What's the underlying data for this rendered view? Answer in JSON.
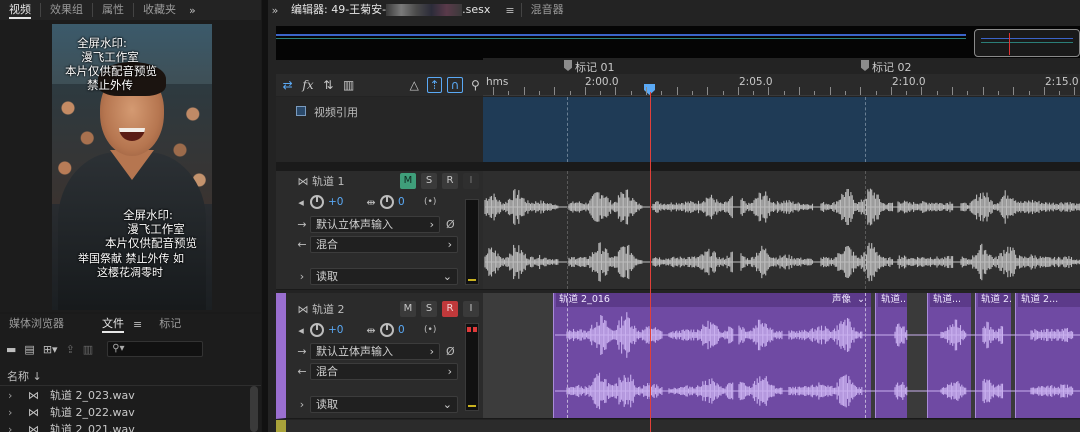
{
  "left_panel": {
    "tabs": [
      "视频",
      "效果组",
      "属性",
      "收藏夹"
    ],
    "watermark_top": [
      "全屏水印:",
      "漫飞工作室",
      "本片仅供配音预览",
      "禁止外传"
    ],
    "watermark_bottom": [
      "全屏水印:",
      "漫飞工作室",
      "本片仅供配音预览"
    ],
    "subtitle": [
      "举国祭献 禁止外传 如",
      "这樱花凋零时"
    ]
  },
  "media_panel": {
    "tabs": [
      "媒体浏览器",
      "文件",
      "标记"
    ],
    "column_name": "名称",
    "files": [
      "轨道 2_023.wav",
      "轨道 2_022.wav",
      "轨道 2_021.wav"
    ]
  },
  "editor": {
    "title": "编辑器: 49-王菊安-",
    "title_ext": ".sesx",
    "mixer_tab": "混音器",
    "markers": [
      {
        "label": "标记 01",
        "time": "1:57.5"
      },
      {
        "label": "标记 02",
        "time": "2:07.6"
      }
    ],
    "ruler": {
      "unit": "hms",
      "labels": [
        "2:00.0",
        "2:05.0",
        "2:10.0",
        "2:15.0"
      ]
    },
    "video_track": {
      "name": "视频引用"
    },
    "tracks": [
      {
        "name": "轨道 1",
        "volume": "+0",
        "pan": "0",
        "input": "默认立体声输入",
        "output": "混合",
        "automation": "读取",
        "mute": "M",
        "solo": "S",
        "record": "R",
        "monitor": "I"
      },
      {
        "name": "轨道 2",
        "volume": "+0",
        "pan": "0",
        "input": "默认立体声输入",
        "output": "混合",
        "automation": "读取",
        "mute": "M",
        "solo": "S",
        "record": "R",
        "monitor": "I",
        "clips": [
          {
            "title": "轨道 2_016",
            "tag": "声像"
          },
          {
            "title": "轨道..."
          },
          {
            "title": "轨道..."
          },
          {
            "title": "轨道 2..."
          },
          {
            "title": "轨道 2..."
          }
        ]
      }
    ]
  },
  "colors": {
    "accent_blue": "#5aa9f5",
    "clip_purple": "#6f4aa3",
    "mute_green": "#3f9e7a",
    "record_red": "#c0393b",
    "playhead": "#e0403a"
  }
}
